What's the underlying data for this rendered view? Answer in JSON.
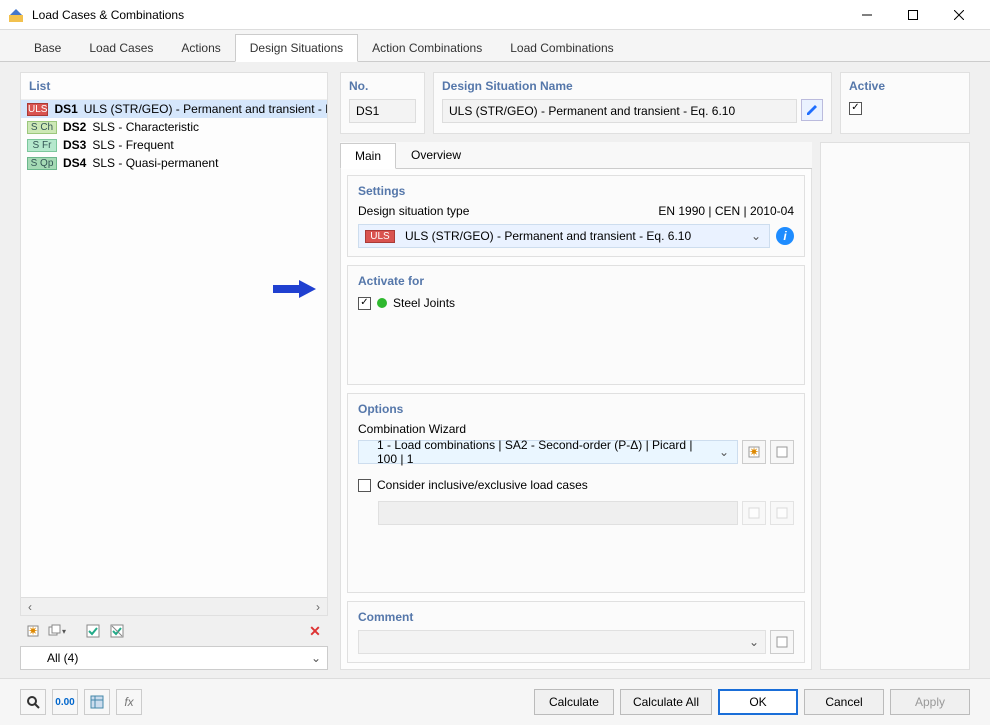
{
  "window": {
    "title": "Load Cases & Combinations"
  },
  "tabs": [
    "Base",
    "Load Cases",
    "Actions",
    "Design Situations",
    "Action Combinations",
    "Load Combinations"
  ],
  "active_tab": 3,
  "list": {
    "title": "List",
    "items": [
      {
        "badge": "ULS",
        "cls": "uls",
        "id": "DS1",
        "name": "ULS (STR/GEO) - Permanent and transient - E..."
      },
      {
        "badge": "S Ch",
        "cls": "sch",
        "id": "DS2",
        "name": "SLS - Characteristic"
      },
      {
        "badge": "S Fr",
        "cls": "sfr",
        "id": "DS3",
        "name": "SLS - Frequent"
      },
      {
        "badge": "S Qp",
        "cls": "sqp",
        "id": "DS4",
        "name": "SLS - Quasi-permanent"
      }
    ],
    "filter": "All (4)"
  },
  "header": {
    "no_label": "No.",
    "no_value": "DS1",
    "name_label": "Design Situation Name",
    "name_value": "ULS (STR/GEO) - Permanent and transient - Eq. 6.10",
    "active_label": "Active",
    "active_checked": true
  },
  "subtabs": [
    "Main",
    "Overview"
  ],
  "settings": {
    "title": "Settings",
    "type_label": "Design situation type",
    "standard": "EN 1990 | CEN | 2010-04",
    "type_badge": "ULS",
    "type_value": "ULS (STR/GEO) - Permanent and transient - Eq. 6.10"
  },
  "activate": {
    "title": "Activate for",
    "item": "Steel Joints",
    "checked": true
  },
  "options": {
    "title": "Options",
    "wizard_label": "Combination Wizard",
    "wizard_value": "1 - Load combinations | SA2 - Second-order (P-Δ) | Picard | 100 | 1",
    "consider_label": "Consider inclusive/exclusive load cases",
    "consider_checked": false
  },
  "comment": {
    "title": "Comment"
  },
  "footer": {
    "calculate": "Calculate",
    "calculate_all": "Calculate All",
    "ok": "OK",
    "cancel": "Cancel",
    "apply": "Apply"
  }
}
